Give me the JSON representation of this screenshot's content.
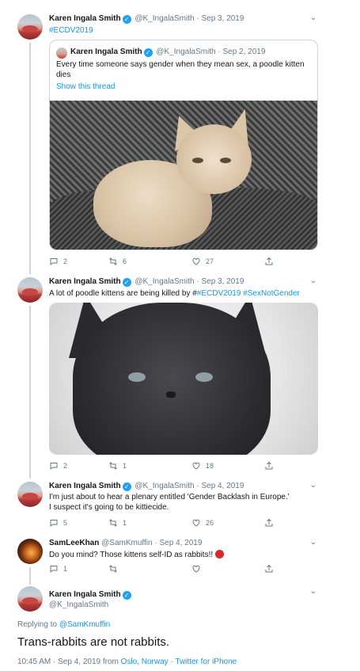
{
  "tweets": [
    {
      "name": "Karen Ingala Smith",
      "handle": "@K_IngalaSmith",
      "date": "Sep 3, 2019",
      "text": "",
      "hashtag": "#ECDV2019",
      "quote": {
        "name": "Karen Ingala Smith",
        "handle": "@K_IngalaSmith",
        "date": "Sep 2, 2019",
        "text": "Every time someone says gender when they mean sex, a poodle kitten dies",
        "show_thread": "Show this thread"
      },
      "replies": "2",
      "retweets": "6",
      "likes": "27"
    },
    {
      "name": "Karen Ingala Smith",
      "handle": "@K_IngalaSmith",
      "date": "Sep 3, 2019",
      "text": "A lot of poodle kittens are being killed by #",
      "hashtag1": "#ECDV2019",
      "hashtag2": "#SexNotGender",
      "replies": "2",
      "retweets": "1",
      "likes": "18"
    },
    {
      "name": "Karen Ingala Smith",
      "handle": "@K_IngalaSmith",
      "date": "Sep 4, 2019",
      "line1": "I'm just about to hear a plenary entitled 'Gender Backlash in Europe.'",
      "line2": "I suspect it's going to be kittiecide.",
      "replies": "5",
      "retweets": "1",
      "likes": "26"
    },
    {
      "name": "SamLeeKhan",
      "handle": "@SamKmuffin",
      "date": "Sep 4, 2019",
      "text": "Do you mind? Those kittens self-ID as rabbits!!",
      "replies": "1",
      "retweets": "",
      "likes": ""
    }
  ],
  "main_tweet": {
    "name": "Karen Ingala Smith",
    "handle": "@K_IngalaSmith",
    "replying_prefix": "Replying to",
    "replying_to": "@SamKmuffin",
    "text": "Trans-rabbits are not rabbits.",
    "time": "10:45 AM · Sep 4, 2019 from",
    "location": "Oslo, Norway",
    "separator": "·",
    "source": "Twitter for iPhone"
  },
  "icons": {
    "verified": "verified-badge-icon",
    "reply": "reply-icon",
    "retweet": "retweet-icon",
    "like": "heart-icon",
    "share": "share-icon",
    "more": "chevron-down-icon"
  },
  "colors": {
    "link": "#1b95e0",
    "verified": "#1da1f2",
    "muted": "#657786",
    "text": "#14171a",
    "thread_line": "#ccd6dd"
  }
}
